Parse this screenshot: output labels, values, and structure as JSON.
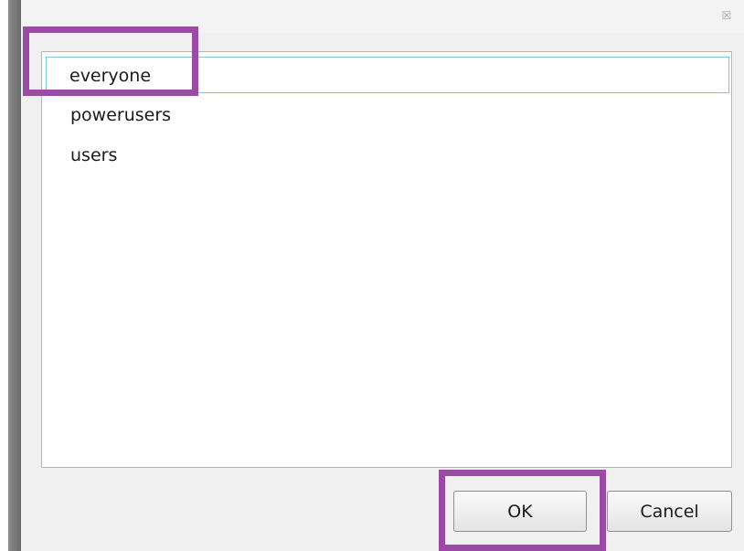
{
  "dialog": {
    "close_glyph": "☒"
  },
  "list": {
    "items": [
      {
        "label": "everyone",
        "selected": true
      },
      {
        "label": "powerusers",
        "selected": false
      },
      {
        "label": "users",
        "selected": false
      }
    ]
  },
  "buttons": {
    "ok_label": "OK",
    "cancel_label": "Cancel"
  },
  "colors": {
    "highlight": "#9b4aa6",
    "selection_border": "#7fc4d9"
  }
}
